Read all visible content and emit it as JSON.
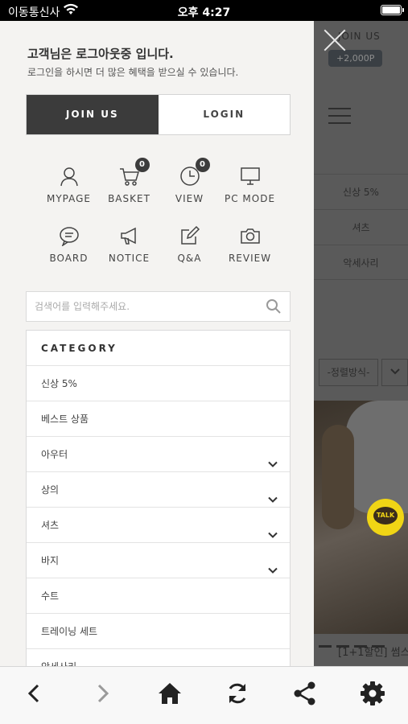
{
  "status_bar": {
    "carrier": "이동통신사",
    "time": "오후 4:27"
  },
  "drawer": {
    "greeting_title": "고객님은 로그아웃중 입니다.",
    "greeting_sub": "로그인을 하시면 더 많은 혜택을 받으실 수 있습니다.",
    "join_label": "JOIN US",
    "login_label": "LOGIN",
    "quick_menu": [
      {
        "label": "MYPAGE",
        "icon": "user-icon"
      },
      {
        "label": "BASKET",
        "icon": "cart-icon",
        "badge": "0"
      },
      {
        "label": "VIEW",
        "icon": "clock-icon",
        "badge": "0"
      },
      {
        "label": "PC MODE",
        "icon": "monitor-icon"
      },
      {
        "label": "BOARD",
        "icon": "chat-icon"
      },
      {
        "label": "NOTICE",
        "icon": "megaphone-icon"
      },
      {
        "label": "Q&A",
        "icon": "edit-icon"
      },
      {
        "label": "REVIEW",
        "icon": "camera-icon"
      }
    ],
    "search_placeholder": "검색어를 입력해주세요.",
    "category_title": "CATEGORY",
    "categories": [
      {
        "label": "신상 5%",
        "expandable": false
      },
      {
        "label": "베스트 상품",
        "expandable": false
      },
      {
        "label": "아우터",
        "expandable": true
      },
      {
        "label": "상의",
        "expandable": true
      },
      {
        "label": "셔츠",
        "expandable": true
      },
      {
        "label": "바지",
        "expandable": true
      },
      {
        "label": "수트",
        "expandable": false
      },
      {
        "label": "트레이닝 세트",
        "expandable": false
      },
      {
        "label": "악세사리",
        "expandable": true
      }
    ]
  },
  "background_page": {
    "join_us": "JOIN US",
    "point_badge": "+2,000P",
    "band_items": [
      "신상 5%",
      "셔츠",
      "악세사리"
    ],
    "sort_label": "-정렬방식-",
    "product_title": "[1+1할인] 썸스",
    "talk_label": "TALK"
  },
  "toolbar": {
    "icons": [
      "back-icon",
      "forward-icon",
      "home-icon",
      "refresh-icon",
      "share-icon",
      "settings-icon"
    ]
  },
  "colors": {
    "drawer_bg": "#f4f3f1",
    "join_button": "#3b3b3b",
    "talk_yellow": "#f0d515"
  }
}
